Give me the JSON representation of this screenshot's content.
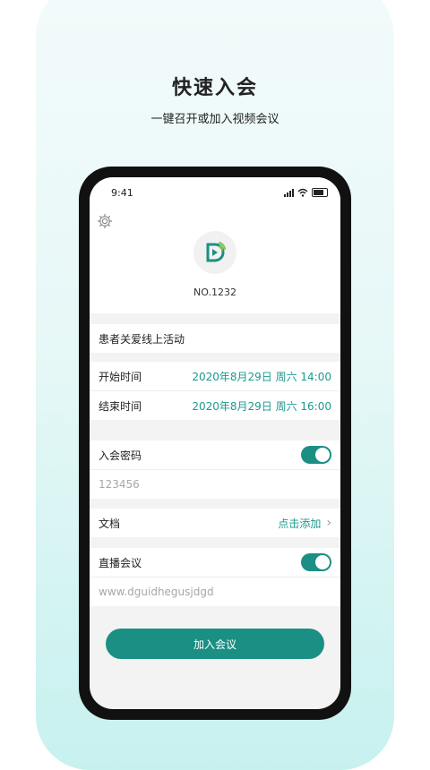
{
  "hero": {
    "title": "快速入会",
    "subtitle": "一键召开或加入视频会议"
  },
  "status_bar": {
    "time": "9:41",
    "icons": [
      "signal-icon",
      "wifi-icon",
      "battery-icon"
    ]
  },
  "header": {
    "settings_icon": "gear-icon",
    "logo_icon": "logo-icon",
    "meeting_number": "NO.1232"
  },
  "form": {
    "topic": "患者关爱线上活动",
    "start_label": "开始时间",
    "start_value": "2020年8月29日  周六 14:00",
    "end_label": "结束时间",
    "end_value": "2020年8月29日  周六 16:00",
    "password_label": "入会密码",
    "password_enabled": true,
    "password_value": "123456",
    "doc_label": "文档",
    "doc_action": "点击添加",
    "live_label": "直播会议",
    "live_enabled": true,
    "live_url": "www.dguidhegusjdgd"
  },
  "actions": {
    "join_label": "加入会议"
  },
  "colors": {
    "accent": "#1b8f83",
    "accent_text": "#1a9a8f",
    "background_tint": "#e7f8f7"
  }
}
